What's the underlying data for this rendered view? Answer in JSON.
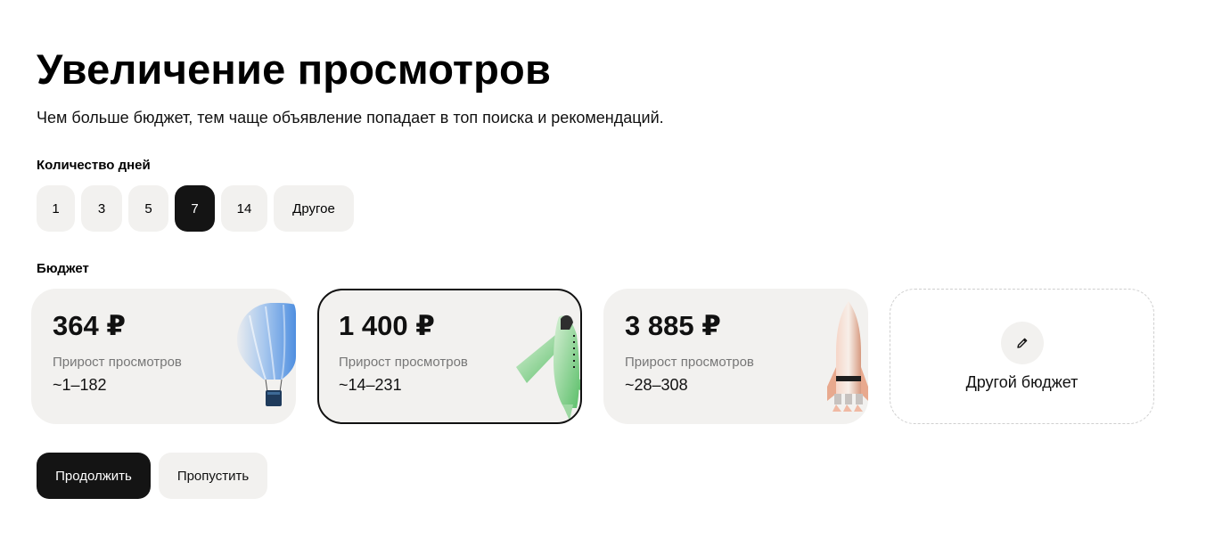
{
  "title": "Увеличение просмотров",
  "subtitle": "Чем больше бюджет, тем чаще объявление попадает в топ поиска и рекомендаций.",
  "days": {
    "label": "Количество дней",
    "options": [
      "1",
      "3",
      "5",
      "7",
      "14",
      "Другое"
    ],
    "selected": "7"
  },
  "budget": {
    "label": "Бюджет",
    "cards": [
      {
        "price": "364 ₽",
        "gain_label": "Прирост просмотров",
        "gain_value": "~1–182",
        "icon": "hot-air-balloon-icon"
      },
      {
        "price": "1 400 ₽",
        "gain_label": "Прирост просмотров",
        "gain_value": "~14–231",
        "icon": "airplane-icon",
        "selected": true
      },
      {
        "price": "3 885 ₽",
        "gain_label": "Прирост просмотров",
        "gain_value": "~28–308",
        "icon": "rocket-icon"
      }
    ],
    "custom": {
      "label": "Другой бюджет",
      "icon": "pencil-icon"
    }
  },
  "actions": {
    "continue": "Продолжить",
    "skip": "Пропустить"
  },
  "colors": {
    "selected_bg": "#141414",
    "chip_bg": "#f2f1ef"
  }
}
